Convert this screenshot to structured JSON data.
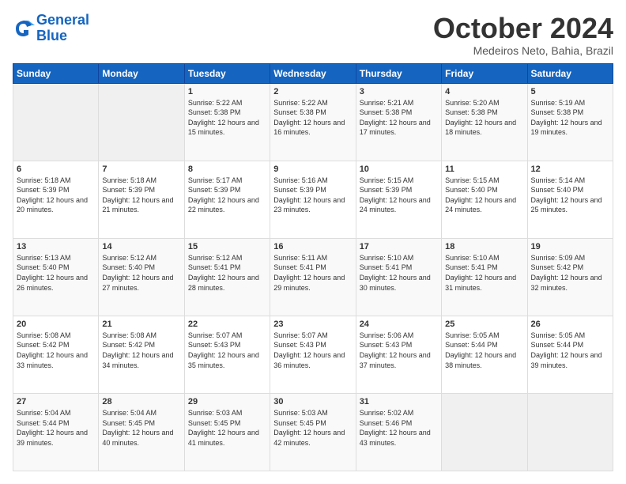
{
  "logo": {
    "line1": "General",
    "line2": "Blue"
  },
  "title": "October 2024",
  "location": "Medeiros Neto, Bahia, Brazil",
  "weekdays": [
    "Sunday",
    "Monday",
    "Tuesday",
    "Wednesday",
    "Thursday",
    "Friday",
    "Saturday"
  ],
  "weeks": [
    [
      {
        "day": "",
        "sunrise": "",
        "sunset": "",
        "daylight": ""
      },
      {
        "day": "",
        "sunrise": "",
        "sunset": "",
        "daylight": ""
      },
      {
        "day": "1",
        "sunrise": "Sunrise: 5:22 AM",
        "sunset": "Sunset: 5:38 PM",
        "daylight": "Daylight: 12 hours and 15 minutes."
      },
      {
        "day": "2",
        "sunrise": "Sunrise: 5:22 AM",
        "sunset": "Sunset: 5:38 PM",
        "daylight": "Daylight: 12 hours and 16 minutes."
      },
      {
        "day": "3",
        "sunrise": "Sunrise: 5:21 AM",
        "sunset": "Sunset: 5:38 PM",
        "daylight": "Daylight: 12 hours and 17 minutes."
      },
      {
        "day": "4",
        "sunrise": "Sunrise: 5:20 AM",
        "sunset": "Sunset: 5:38 PM",
        "daylight": "Daylight: 12 hours and 18 minutes."
      },
      {
        "day": "5",
        "sunrise": "Sunrise: 5:19 AM",
        "sunset": "Sunset: 5:38 PM",
        "daylight": "Daylight: 12 hours and 19 minutes."
      }
    ],
    [
      {
        "day": "6",
        "sunrise": "Sunrise: 5:18 AM",
        "sunset": "Sunset: 5:39 PM",
        "daylight": "Daylight: 12 hours and 20 minutes."
      },
      {
        "day": "7",
        "sunrise": "Sunrise: 5:18 AM",
        "sunset": "Sunset: 5:39 PM",
        "daylight": "Daylight: 12 hours and 21 minutes."
      },
      {
        "day": "8",
        "sunrise": "Sunrise: 5:17 AM",
        "sunset": "Sunset: 5:39 PM",
        "daylight": "Daylight: 12 hours and 22 minutes."
      },
      {
        "day": "9",
        "sunrise": "Sunrise: 5:16 AM",
        "sunset": "Sunset: 5:39 PM",
        "daylight": "Daylight: 12 hours and 23 minutes."
      },
      {
        "day": "10",
        "sunrise": "Sunrise: 5:15 AM",
        "sunset": "Sunset: 5:39 PM",
        "daylight": "Daylight: 12 hours and 24 minutes."
      },
      {
        "day": "11",
        "sunrise": "Sunrise: 5:15 AM",
        "sunset": "Sunset: 5:40 PM",
        "daylight": "Daylight: 12 hours and 24 minutes."
      },
      {
        "day": "12",
        "sunrise": "Sunrise: 5:14 AM",
        "sunset": "Sunset: 5:40 PM",
        "daylight": "Daylight: 12 hours and 25 minutes."
      }
    ],
    [
      {
        "day": "13",
        "sunrise": "Sunrise: 5:13 AM",
        "sunset": "Sunset: 5:40 PM",
        "daylight": "Daylight: 12 hours and 26 minutes."
      },
      {
        "day": "14",
        "sunrise": "Sunrise: 5:12 AM",
        "sunset": "Sunset: 5:40 PM",
        "daylight": "Daylight: 12 hours and 27 minutes."
      },
      {
        "day": "15",
        "sunrise": "Sunrise: 5:12 AM",
        "sunset": "Sunset: 5:41 PM",
        "daylight": "Daylight: 12 hours and 28 minutes."
      },
      {
        "day": "16",
        "sunrise": "Sunrise: 5:11 AM",
        "sunset": "Sunset: 5:41 PM",
        "daylight": "Daylight: 12 hours and 29 minutes."
      },
      {
        "day": "17",
        "sunrise": "Sunrise: 5:10 AM",
        "sunset": "Sunset: 5:41 PM",
        "daylight": "Daylight: 12 hours and 30 minutes."
      },
      {
        "day": "18",
        "sunrise": "Sunrise: 5:10 AM",
        "sunset": "Sunset: 5:41 PM",
        "daylight": "Daylight: 12 hours and 31 minutes."
      },
      {
        "day": "19",
        "sunrise": "Sunrise: 5:09 AM",
        "sunset": "Sunset: 5:42 PM",
        "daylight": "Daylight: 12 hours and 32 minutes."
      }
    ],
    [
      {
        "day": "20",
        "sunrise": "Sunrise: 5:08 AM",
        "sunset": "Sunset: 5:42 PM",
        "daylight": "Daylight: 12 hours and 33 minutes."
      },
      {
        "day": "21",
        "sunrise": "Sunrise: 5:08 AM",
        "sunset": "Sunset: 5:42 PM",
        "daylight": "Daylight: 12 hours and 34 minutes."
      },
      {
        "day": "22",
        "sunrise": "Sunrise: 5:07 AM",
        "sunset": "Sunset: 5:43 PM",
        "daylight": "Daylight: 12 hours and 35 minutes."
      },
      {
        "day": "23",
        "sunrise": "Sunrise: 5:07 AM",
        "sunset": "Sunset: 5:43 PM",
        "daylight": "Daylight: 12 hours and 36 minutes."
      },
      {
        "day": "24",
        "sunrise": "Sunrise: 5:06 AM",
        "sunset": "Sunset: 5:43 PM",
        "daylight": "Daylight: 12 hours and 37 minutes."
      },
      {
        "day": "25",
        "sunrise": "Sunrise: 5:05 AM",
        "sunset": "Sunset: 5:44 PM",
        "daylight": "Daylight: 12 hours and 38 minutes."
      },
      {
        "day": "26",
        "sunrise": "Sunrise: 5:05 AM",
        "sunset": "Sunset: 5:44 PM",
        "daylight": "Daylight: 12 hours and 39 minutes."
      }
    ],
    [
      {
        "day": "27",
        "sunrise": "Sunrise: 5:04 AM",
        "sunset": "Sunset: 5:44 PM",
        "daylight": "Daylight: 12 hours and 39 minutes."
      },
      {
        "day": "28",
        "sunrise": "Sunrise: 5:04 AM",
        "sunset": "Sunset: 5:45 PM",
        "daylight": "Daylight: 12 hours and 40 minutes."
      },
      {
        "day": "29",
        "sunrise": "Sunrise: 5:03 AM",
        "sunset": "Sunset: 5:45 PM",
        "daylight": "Daylight: 12 hours and 41 minutes."
      },
      {
        "day": "30",
        "sunrise": "Sunrise: 5:03 AM",
        "sunset": "Sunset: 5:45 PM",
        "daylight": "Daylight: 12 hours and 42 minutes."
      },
      {
        "day": "31",
        "sunrise": "Sunrise: 5:02 AM",
        "sunset": "Sunset: 5:46 PM",
        "daylight": "Daylight: 12 hours and 43 minutes."
      },
      {
        "day": "",
        "sunrise": "",
        "sunset": "",
        "daylight": ""
      },
      {
        "day": "",
        "sunrise": "",
        "sunset": "",
        "daylight": ""
      }
    ]
  ]
}
